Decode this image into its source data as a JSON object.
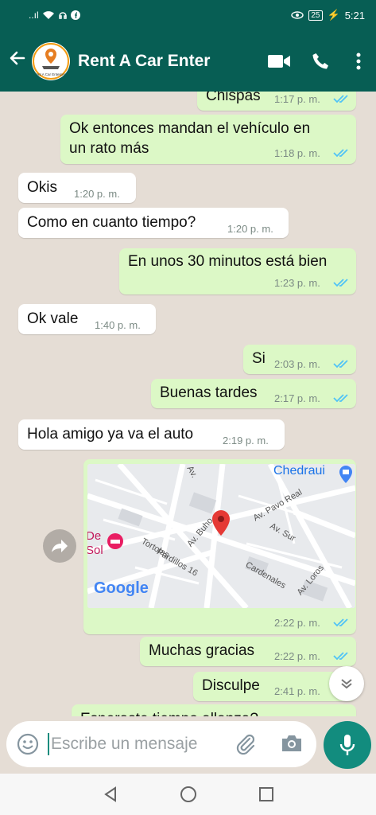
{
  "status_bar": {
    "time": "5:21",
    "battery": "25",
    "network": "..ıl"
  },
  "header": {
    "back_icon": "arrow-left-icon",
    "title": "Rent A Car Enter",
    "avatar_text": "Rent A Car Enterprise"
  },
  "messages": [
    {
      "dir": "out",
      "text": "Chispas",
      "time": "1:17 p. m.",
      "status": "read"
    },
    {
      "dir": "out",
      "text_lines": [
        "Ok entonces mandan el vehículo en",
        "un rato más"
      ],
      "time": "1:18 p. m.",
      "status": "read"
    },
    {
      "dir": "in",
      "text": "Okis",
      "time": "1:20 p. m."
    },
    {
      "dir": "in",
      "text": "Como en cuanto tiempo?",
      "time": "1:20 p. m."
    },
    {
      "dir": "out",
      "text": "En unos 30 minutos está bien",
      "time": "1:23 p. m.",
      "status": "read"
    },
    {
      "dir": "in",
      "text": "Ok vale",
      "time": "1:40 p. m."
    },
    {
      "dir": "out",
      "text": "Si",
      "time": "2:03 p. m.",
      "status": "read"
    },
    {
      "dir": "out",
      "text": "Buenas tardes",
      "time": "2:17 p. m.",
      "status": "read"
    },
    {
      "dir": "in",
      "text": "Hola amigo ya va el auto",
      "time": "2:19 p. m."
    },
    {
      "dir": "out",
      "type": "location",
      "time": "2:22 p. m.",
      "status": "read"
    },
    {
      "dir": "out",
      "text": "Muchas gracias",
      "time": "2:22 p. m.",
      "status": "read"
    },
    {
      "dir": "out",
      "text": "Disculpe",
      "time": "2:41 p. m."
    },
    {
      "dir": "out",
      "text": "Esperaste tiempo allanza?",
      "partial": true
    }
  ],
  "map": {
    "place_labels": [
      "Chedraui",
      "De",
      "Sol"
    ],
    "street_labels": [
      "Av. Pavo Real",
      "Av. Sur",
      "Av. Buho",
      "Tortolas",
      "Pardillos 16",
      "Cardenales",
      "Av. Loros",
      "Av."
    ],
    "brand": "Google"
  },
  "input": {
    "placeholder": "Escribe un mensaje"
  },
  "colors": {
    "header": "#075e54",
    "outgoing": "#dcf8c6",
    "incoming": "#ffffff",
    "background": "#e5ddd5",
    "accent": "#128c7e",
    "ticks": "#4fc3f7"
  },
  "icons": [
    "video-call-icon",
    "phone-icon",
    "more-options-icon",
    "emoji-icon",
    "attach-icon",
    "camera-icon",
    "mic-icon",
    "forward-icon",
    "scroll-down-icon"
  ]
}
